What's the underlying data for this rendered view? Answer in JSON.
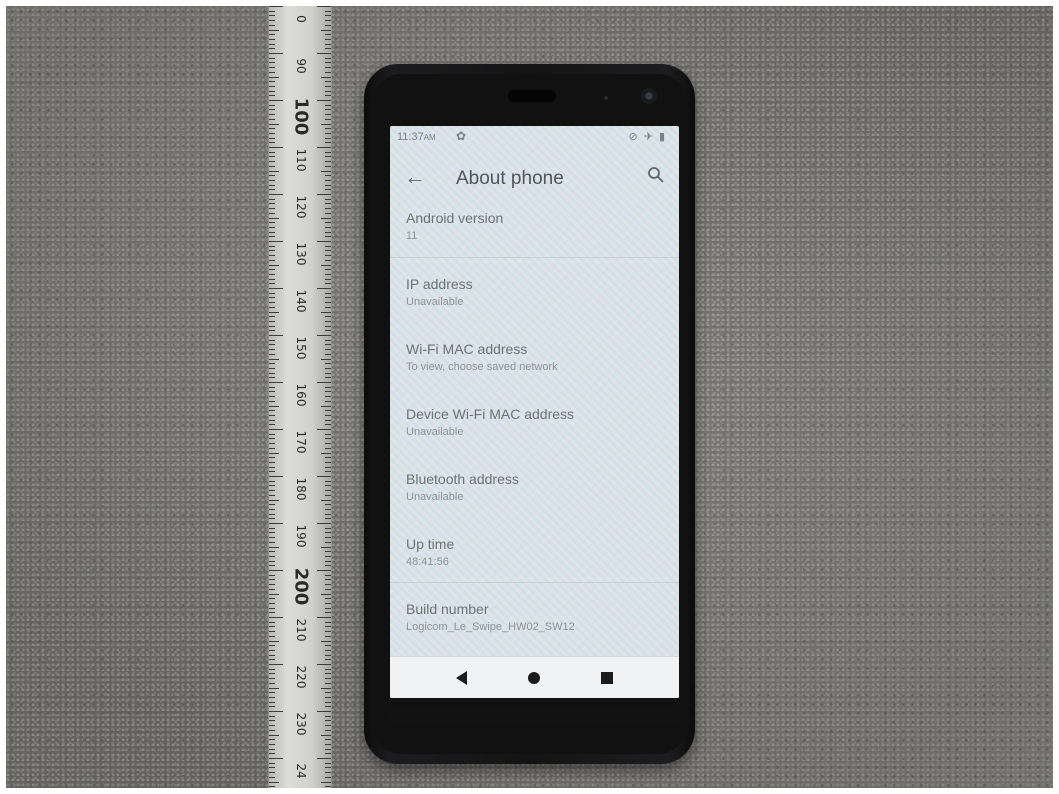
{
  "status_bar": {
    "time": "11:37",
    "ampm": "AM",
    "icons": [
      "settings-icon",
      "mute-icon",
      "airplane-icon",
      "battery-icon"
    ]
  },
  "app_bar": {
    "title": "About phone",
    "back_icon": "arrow-back-icon",
    "search_icon": "search-icon"
  },
  "items": [
    {
      "title": "Android version",
      "subtitle": "11"
    },
    {
      "title": "IP address",
      "subtitle": "Unavailable"
    },
    {
      "title": "Wi-Fi MAC address",
      "subtitle": "To view, choose saved network"
    },
    {
      "title": "Device Wi-Fi MAC address",
      "subtitle": "Unavailable"
    },
    {
      "title": "Bluetooth address",
      "subtitle": "Unavailable"
    },
    {
      "title": "Up time",
      "subtitle": "48:41:56"
    },
    {
      "title": "Build number",
      "subtitle": "Logicom_Le_Swipe_HW02_SW12"
    }
  ],
  "nav_bar": {
    "back": "nav-back-icon",
    "home": "nav-home-icon",
    "recents": "nav-recents-icon"
  },
  "ruler": {
    "labels": [
      "0",
      "90",
      "100",
      "110",
      "120",
      "130",
      "140",
      "150",
      "160",
      "170",
      "180",
      "190",
      "200",
      "210",
      "220",
      "230",
      "24"
    ]
  },
  "colors": {
    "screen_bg": "#e6eef0",
    "text_primary": "#505759",
    "navbar_bg": "#f1f2f3"
  }
}
